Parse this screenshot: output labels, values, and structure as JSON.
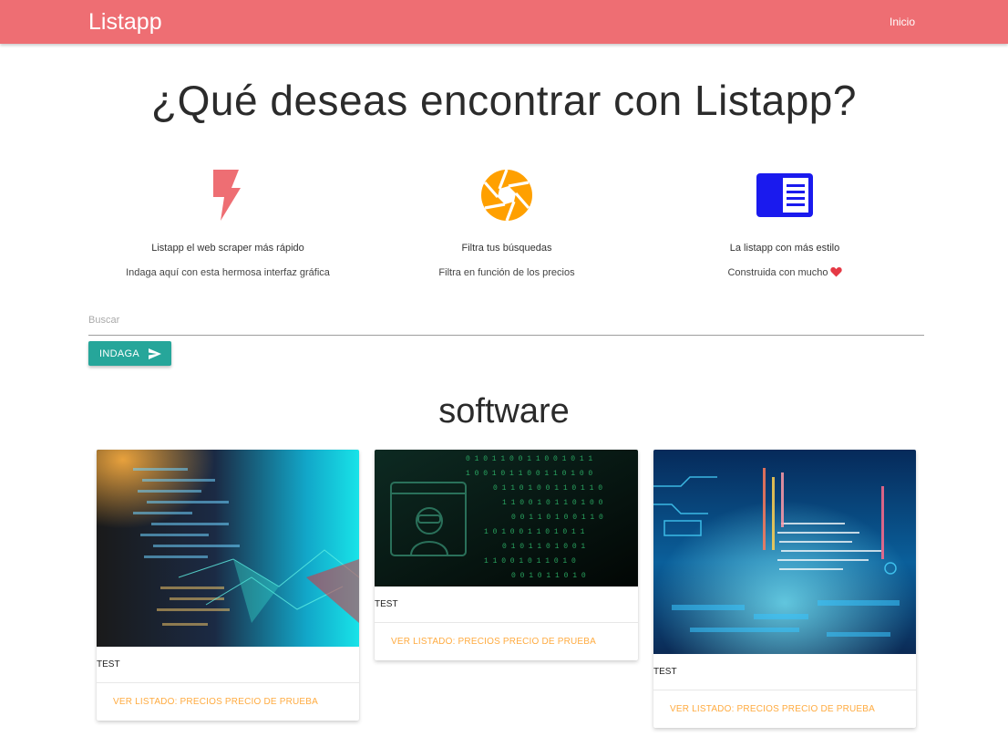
{
  "nav": {
    "brand": "Listapp",
    "link": "Inicio"
  },
  "headline": "¿Qué deseas encontrar con Listapp?",
  "features": [
    {
      "icon": "flash-icon",
      "title": "Listapp el web scraper más rápido",
      "subtitle": "Indaga aquí con esta hermosa interfaz gráfica"
    },
    {
      "icon": "camera-shutter-icon",
      "title": "Filtra tus búsquedas",
      "subtitle": "Filtra en función de los precios"
    },
    {
      "icon": "chrome-reader-icon",
      "title": "La listapp con más estilo",
      "subtitle": "Construida con mucho"
    }
  ],
  "search": {
    "placeholder": "Buscar",
    "value": "",
    "button_label": "INDAGA"
  },
  "section_title": "software",
  "cards": [
    {
      "caption": "TEST",
      "action": "VER LISTADO: PRECIOS PRECIO DE PRUEBA"
    },
    {
      "caption": "TEST",
      "action": "VER LISTADO: PRECIOS PRECIO DE PRUEBA"
    },
    {
      "caption": "TEST",
      "action": "VER LISTADO: PRECIOS PRECIO DE PRUEBA"
    }
  ],
  "colors": {
    "navbar": "#ee6e73",
    "button": "#26a69a",
    "flash": "#ee6e73",
    "shutter": "#ffa000",
    "reader": "#1a1aee",
    "link": "#ffab40"
  }
}
